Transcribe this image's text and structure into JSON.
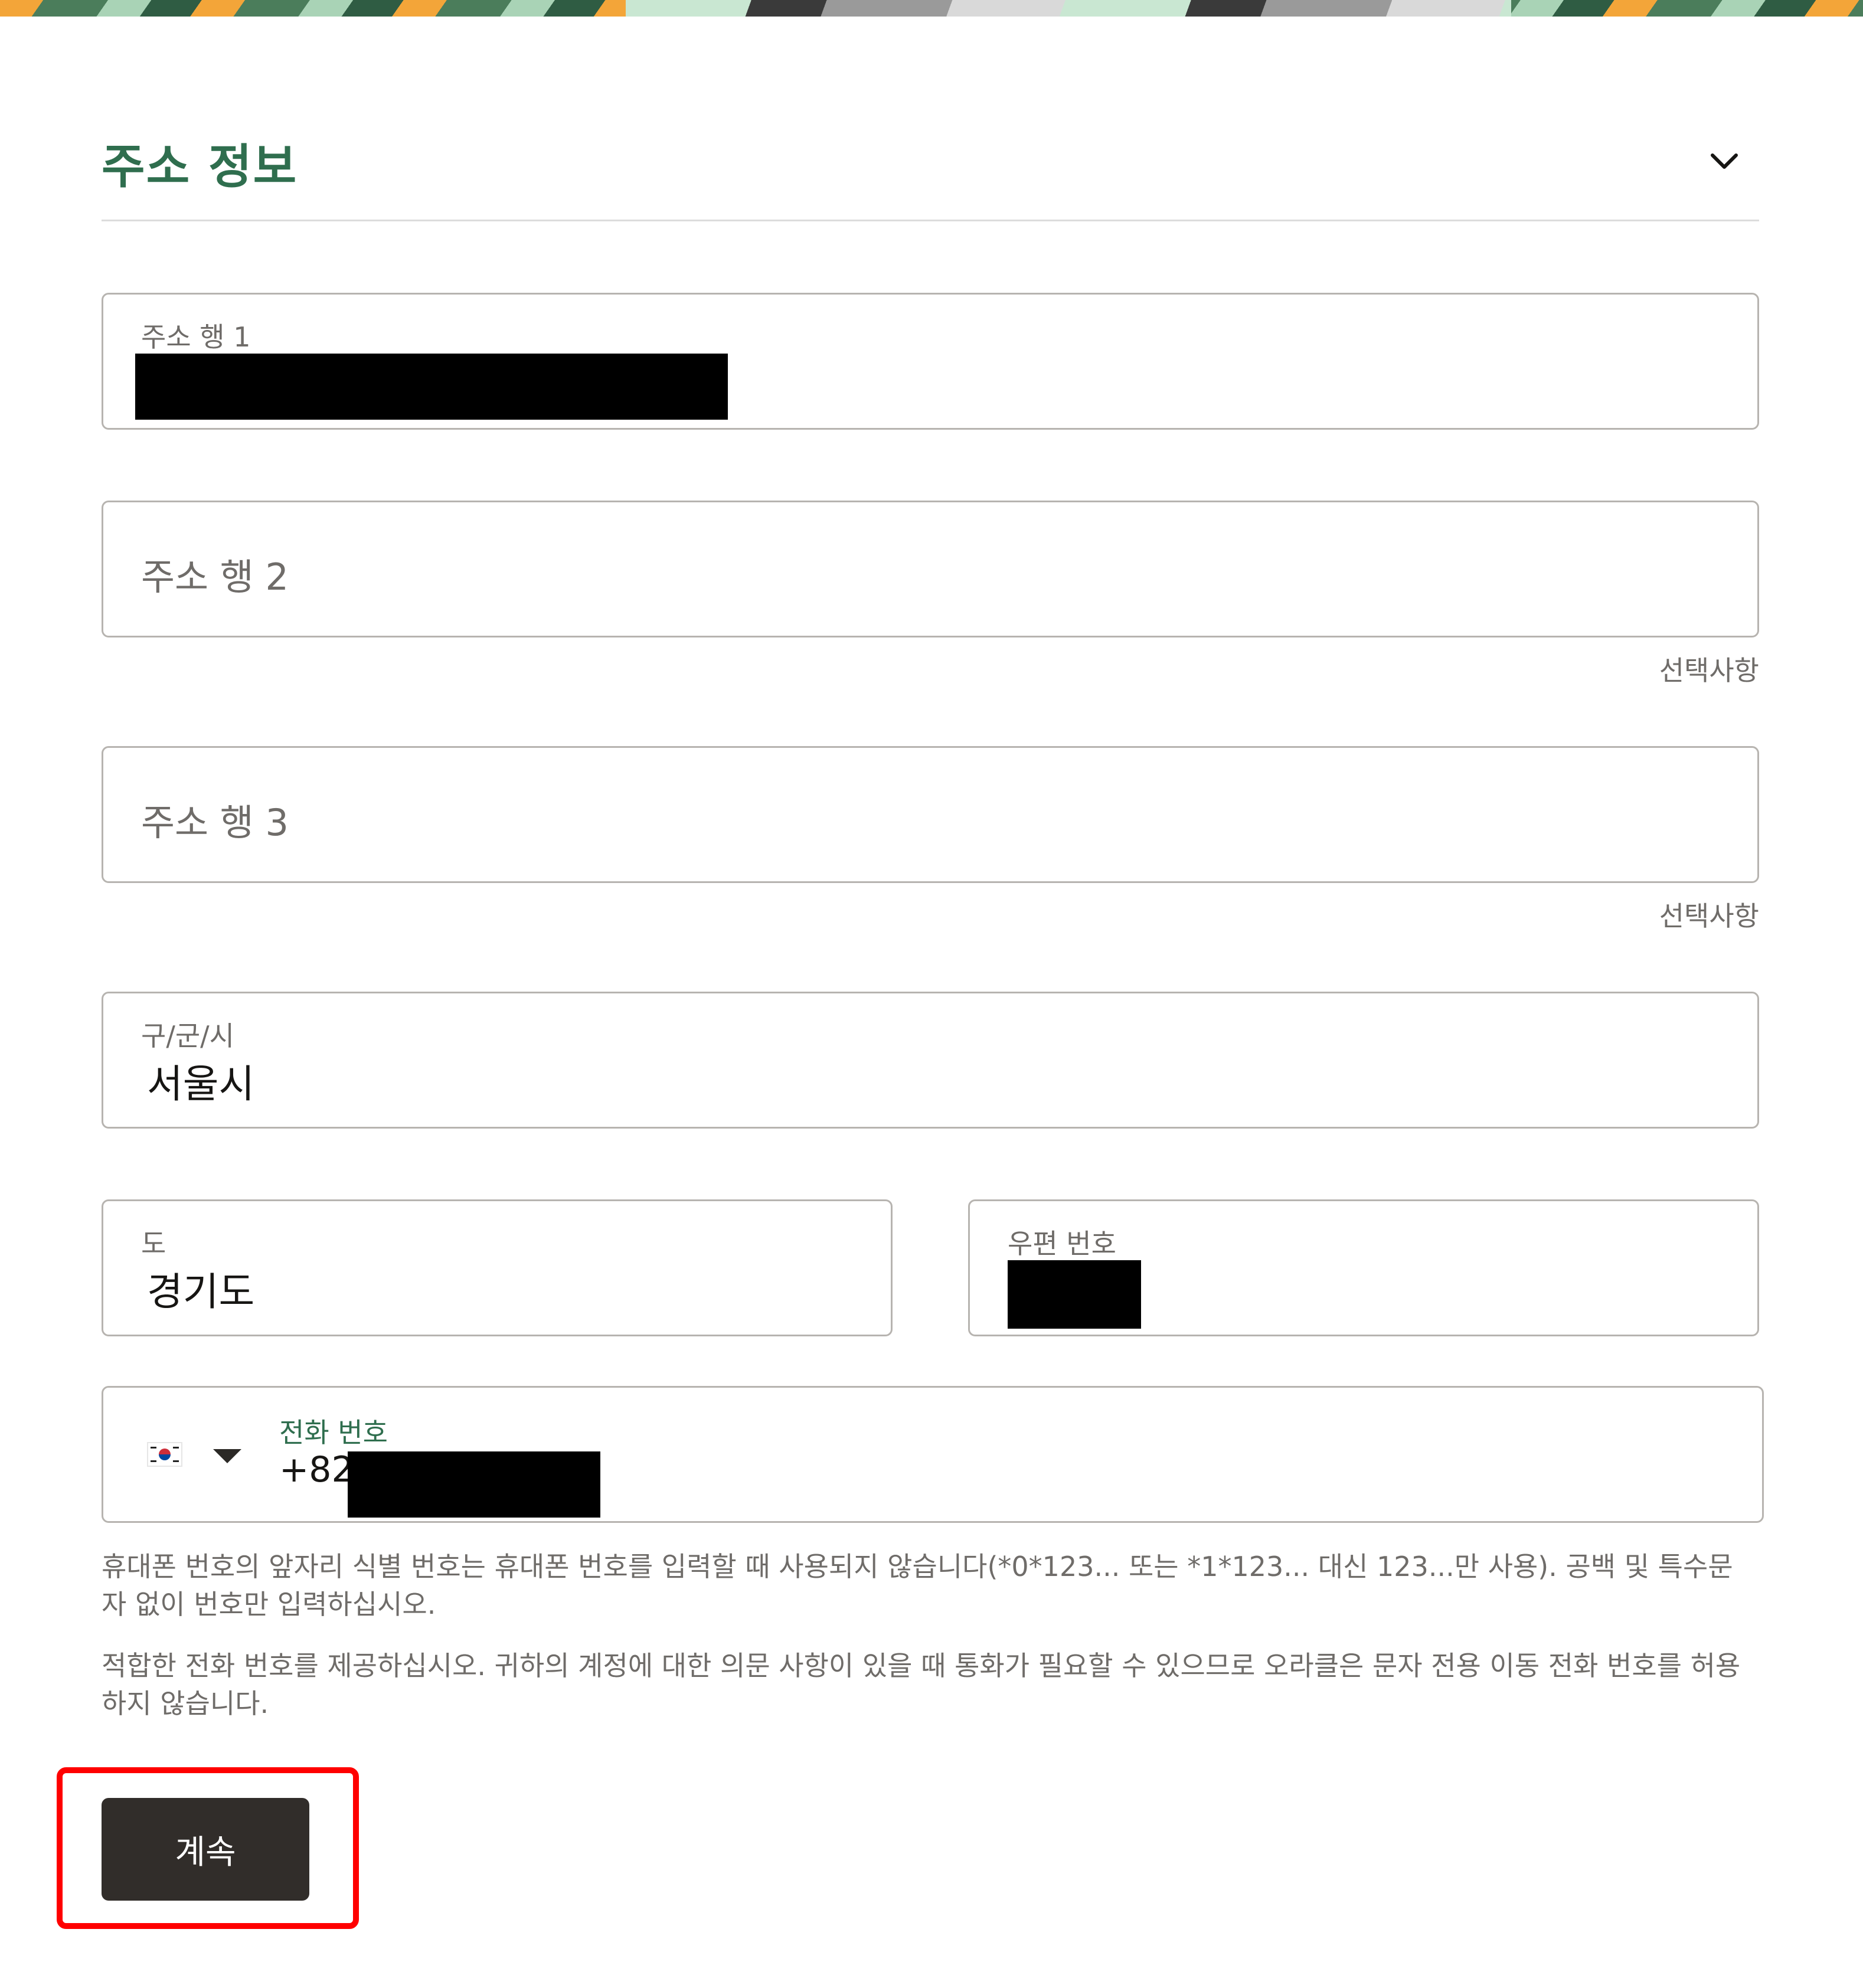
{
  "section": {
    "title": "주소 정보",
    "collapse_icon": "chevron-down-icon"
  },
  "address_line_1": {
    "label": "주소 행 1",
    "value": ""
  },
  "address_line_2": {
    "placeholder": "주소 행 2",
    "hint": "선택사항"
  },
  "address_line_3": {
    "placeholder": "주소 행 3",
    "hint": "선택사항"
  },
  "city": {
    "label": "구/군/시",
    "value": "서울시"
  },
  "province": {
    "label": "도",
    "value": "경기도"
  },
  "postal_code": {
    "label": "우편 번호",
    "value": ""
  },
  "phone": {
    "label": "전화 번호",
    "country_code": "+82",
    "flag_icon": "south-korea-flag-icon",
    "dropdown_icon": "caret-down-icon",
    "label_color": "#2f6e4e"
  },
  "help_text": {
    "line1": "휴대폰 번호의 앞자리 식별 번호는 휴대폰 번호를 입력할 때 사용되지 않습니다(*0*123... 또는 *1*123... 대신 123...만 사용). 공백 및 특수문자 없이 번호만 입력하십시오.",
    "line2": "적합한 전화 번호를 제공하십시오. 귀하의 계정에 대한 의문 사항이 있을 때 통화가 필요할 수 있으므로 오라클은 문자 전용 이동 전화 번호를 허용하지 않습니다."
  },
  "continue_button": {
    "label": "계속",
    "background": "#312d2a"
  },
  "colors": {
    "accent": "#2f6e4e",
    "highlight": "#ff0000",
    "border": "#b7b4b0"
  }
}
